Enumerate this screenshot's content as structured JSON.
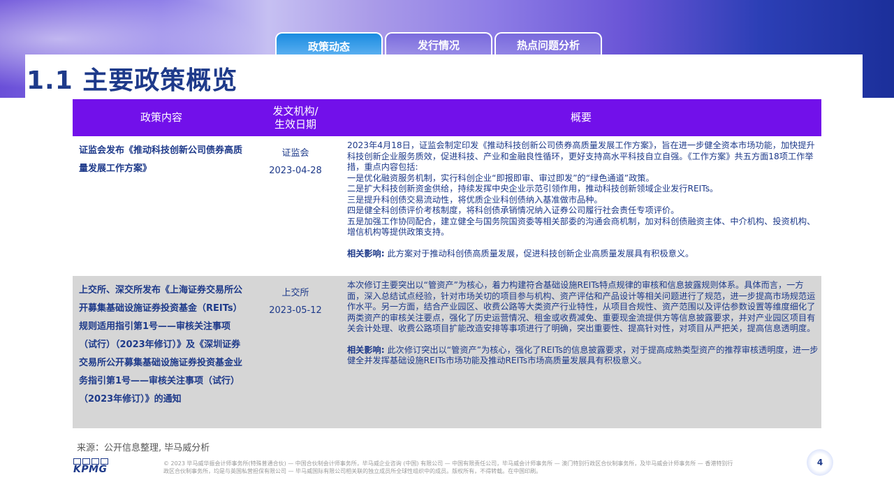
{
  "tabs": [
    {
      "label": "政策动态",
      "active": true
    },
    {
      "label": "发行情况",
      "active": false
    },
    {
      "label": "热点问题分析",
      "active": false
    }
  ],
  "title": "1.1 主要政策概览",
  "table": {
    "headers": [
      "政策内容",
      "发文机构/\n生效日期",
      "概要"
    ],
    "rows": [
      {
        "content": "证监会发布《推动科技创新公司债券高质量发展工作方案》",
        "agency": "证监会",
        "date": "2023-04-28",
        "summary": [
          "2023年4月18日，证监会制定印发《推动科技创新公司债券高质量发展工作方案》，旨在进一步健全资本市场功能，加快提升科技创新企业服务质效，促进科技、产业和金融良性循环，更好支持高水平科技自立自强。《工作方案》共五方面18项工作举措，重点内容包括:",
          "一是优化融资服务机制，实行科创企业“即报即审、审过即发”的“绿色通道”政策。",
          "二是扩大科技创新资金供给，持续发挥中央企业示范引领作用，推动科技创新领域企业发行REITs。",
          "三是提升科创债交易流动性，将优质企业科创债纳入基准做市品种。",
          "四是健全科创债评价考核制度，将科创债承销情况纳入证券公司履行社会责任专项评价。",
          "五是加强工作协同配合，建立健全与国务院国资委等相关部委的沟通会商机制，加对科创债融资主体、中介机构、投资机构、增信机构等提供政策支持。"
        ],
        "impact_label": "相关影响:",
        "impact": "此方案对于推动科创债高质量发展，促进科技创新企业高质量发展具有积极意义。"
      },
      {
        "content": "上交所、深交所发布《上海证券交易所公开募集基础设施证券投资基金（REITs）规则适用指引第1号——审核关注事项（试行）（2023年修订）》及《深圳证券交易所公开募集基础设施证券投资基金业务指引第1号——审核关注事项（试行）（2023年修订）》的通知",
        "agency": "上交所",
        "date": "2023-05-12",
        "summary": [
          "本次修订主要突出以“管资产”为核心，着力构建符合基础设施REITs特点规律的审核和信息披露规则体系。具体而言，一方面，深入总结试点经验，针对市场关切的项目参与机构、资产评估和产品设计等相关问题进行了规范，进一步提高市场规范运作水平。另一方面，结合产业园区、收费公路等大类资产行业特性，从项目合规性、资产范围以及评估参数设置等维度细化了两类资产的审核关注要点，强化了历史运营情况、租金或收费减免、重要现金流提供方等信息披露要求，并对产业园区项目有关会计处理、收费公路项目扩能改造安排等事项进行了明确，突出重要性、提高针对性，对项目从严把关，提高信息透明度。"
        ],
        "impact_label": "相关影响:",
        "impact": "此次修订突出以“管资产”为核心，强化了REITs的信息披露要求，对于提高成熟类型资产的推荐审核透明度，进一步健全并发挥基础设施REITs市场功能及推动REITs市场高质量发展具有积极意义。"
      }
    ]
  },
  "source": "来源：公开信息整理, 毕马威分析",
  "logo_text": "KPMG",
  "footer": "© 2023 毕马威华振会计师事务所(特殊普通合伙) — 中国合伙制会计师事务所，毕马威企业咨询 (中国) 有限公司 — 中国有限责任公司，毕马威会计师事务所 — 澳门特别行政区合伙制事务所，及毕马威会计师事务所 — 香港特别行政区合伙制事务所，均是与英国私营担保有限公司 — 毕马威国际有限公司相关联的独立成员所全球性组织中的成员。版权所有，不得转载。在中国印刷。",
  "page_number": "4",
  "colors": {
    "header_bg": "#7210ea",
    "title": "#1e3a8a",
    "row_alt": "#d6d6d6"
  }
}
